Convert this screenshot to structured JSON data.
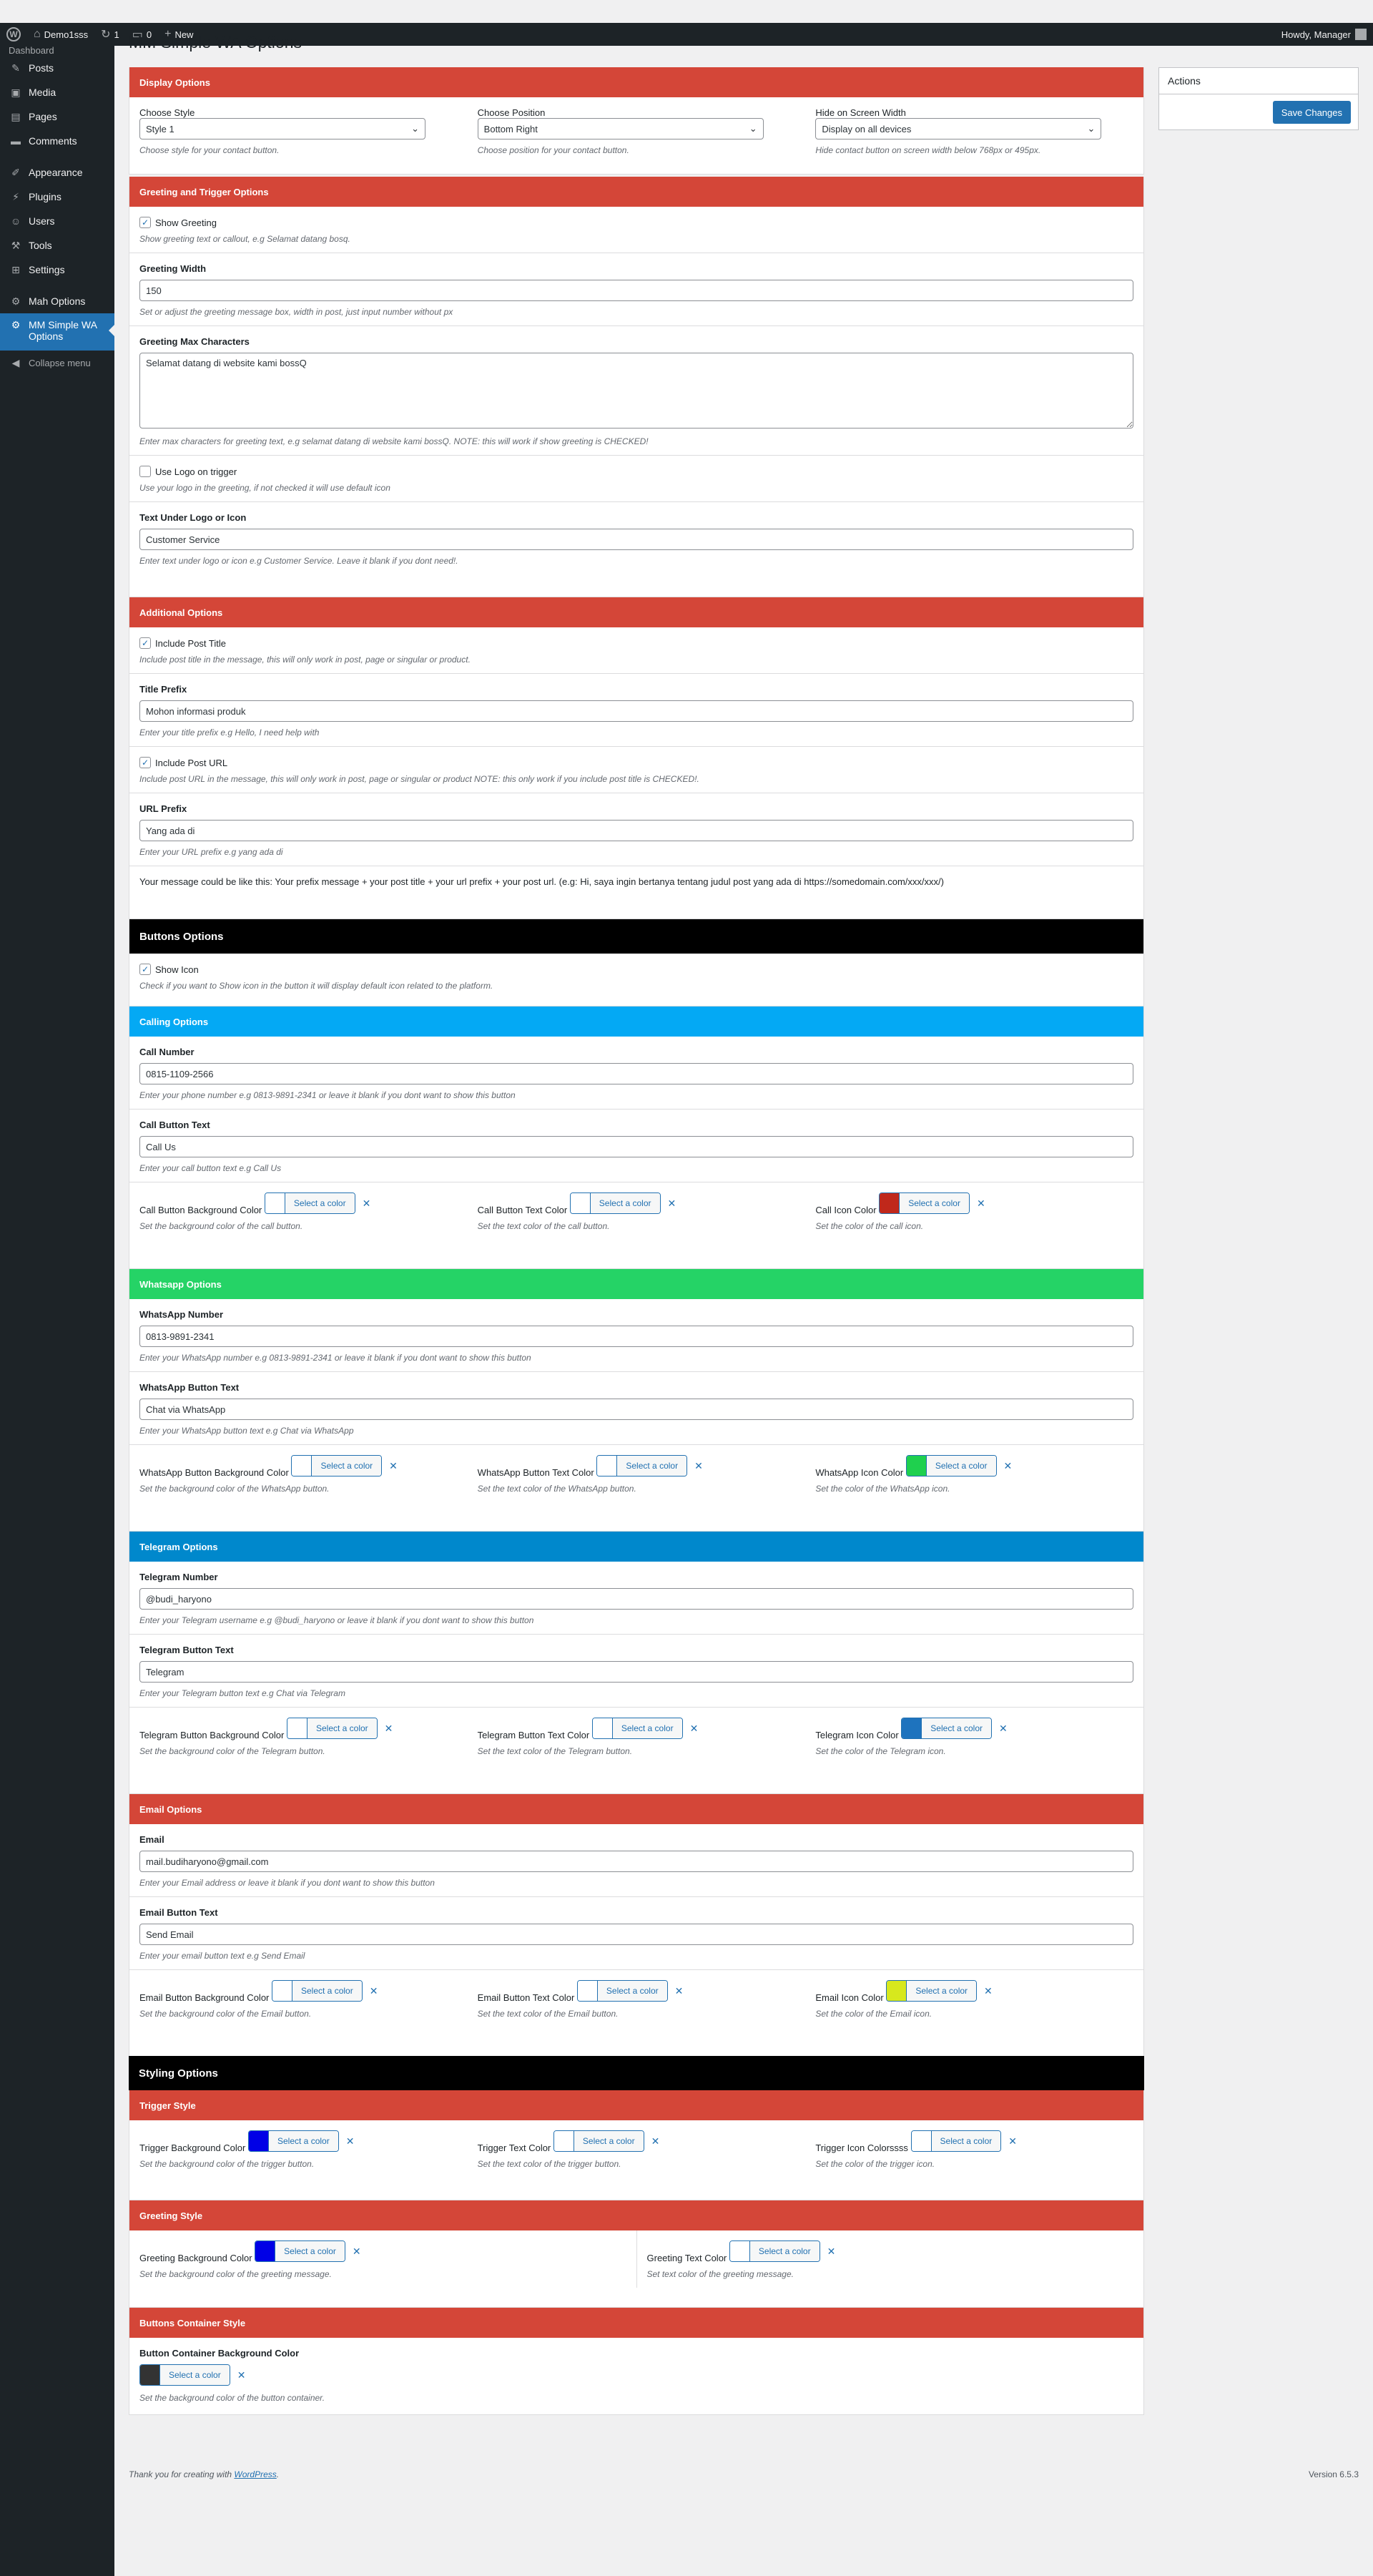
{
  "adminbar": {
    "site": "Demo1sss",
    "updates": "1",
    "comments": "0",
    "new": "New",
    "howdy": "Howdy, Manager"
  },
  "sidebar": {
    "cut": "Dashboard",
    "items": [
      "Posts",
      "Media",
      "Pages",
      "Comments",
      "Appearance",
      "Plugins",
      "Users",
      "Tools",
      "Settings",
      "Mah Options",
      "MM Simple WA Options",
      "Collapse menu"
    ]
  },
  "page_title": "MM Simple WA Options",
  "actions": {
    "title": "Actions",
    "save": "Save Changes"
  },
  "display": {
    "header": "Display Options",
    "style": {
      "label": "Choose Style",
      "value": "Style 1",
      "desc": "Choose style for your contact button."
    },
    "position": {
      "label": "Choose Position",
      "value": "Bottom Right",
      "desc": "Choose position for your contact button."
    },
    "hide": {
      "label": "Hide on Screen Width",
      "value": "Display on all devices",
      "desc": "Hide contact button on screen width below 768px or 495px."
    }
  },
  "greeting": {
    "header": "Greeting and Trigger Options",
    "show": {
      "label": "Show Greeting",
      "desc": "Show greeting text or callout, e.g Selamat datang bosq."
    },
    "width": {
      "label": "Greeting Width",
      "value": "150",
      "desc": "Set or adjust the greeting message box, width in post, just input number without px"
    },
    "max": {
      "label": "Greeting Max Characters",
      "value": "Selamat datang di website kami bossQ",
      "desc": "Enter max characters for greeting text, e.g selamat datang di website kami bossQ. NOTE: this will work if show greeting is CHECKED!"
    },
    "logo": {
      "label": "Use Logo on trigger",
      "desc": "Use your logo in the greeting, if not checked it will use default icon"
    },
    "under": {
      "label": "Text Under Logo or Icon",
      "value": "Customer Service",
      "desc": "Enter text under logo or icon e.g Customer Service. Leave it blank if you dont need!."
    }
  },
  "additional": {
    "header": "Additional Options",
    "title": {
      "label": "Include Post Title",
      "desc": "Include post title in the message, this will only work in post, page or singular or product."
    },
    "prefix": {
      "label": "Title Prefix",
      "value": "Mohon informasi produk",
      "desc": "Enter your title prefix e.g Hello, I need help with"
    },
    "url": {
      "label": "Include Post URL",
      "desc": "Include post URL in the message, this will only work in post, page or singular or product NOTE: this only work if you include post title is CHECKED!."
    },
    "urlprefix": {
      "label": "URL Prefix",
      "value": "Yang ada di",
      "desc": "Enter your URL prefix e.g yang ada di"
    },
    "message": "Your message could be like this: Your prefix message + your post title + your url prefix + your post url. (e.g: Hi, saya ingin bertanya tentang judul post yang ada di https://somedomain.com/xxx/xxx/)"
  },
  "buttons": {
    "header": "Buttons Options",
    "show": {
      "label": "Show Icon",
      "desc": "Check if you want to Show icon in the button it will display default icon related to the platform."
    }
  },
  "select_color": "Select a color",
  "calling": {
    "header": "Calling Options",
    "number": {
      "label": "Call Number",
      "value": "0815-1109-2566",
      "desc": "Enter your phone number e.g 0813-9891-2341 or leave it blank if you dont want to show this button"
    },
    "text": {
      "label": "Call Button Text",
      "value": "Call Us",
      "desc": "Enter your call button text e.g Call Us"
    },
    "c1": {
      "label": "Call Button Background Color",
      "desc": "Set the background color of the call button."
    },
    "c2": {
      "label": "Call Button Text Color",
      "desc": "Set the text color of the call button."
    },
    "c3": {
      "label": "Call Icon Color",
      "desc": "Set the color of the call icon."
    },
    "colors": [
      "#ffffff",
      "#ffffff",
      "#c0281b"
    ]
  },
  "whatsapp": {
    "header": "Whatsapp Options",
    "number": {
      "label": "WhatsApp Number",
      "value": "0813-9891-2341",
      "desc": "Enter your WhatsApp number e.g 0813-9891-2341 or leave it blank if you dont want to show this button"
    },
    "text": {
      "label": "WhatsApp Button Text",
      "value": "Chat via WhatsApp",
      "desc": "Enter your WhatsApp button text e.g Chat via WhatsApp"
    },
    "c1": {
      "label": "WhatsApp Button Background Color",
      "desc": "Set the background color of the WhatsApp button."
    },
    "c2": {
      "label": "WhatsApp Button Text Color",
      "desc": "Set the text color of the WhatsApp button."
    },
    "c3": {
      "label": "WhatsApp Icon Color",
      "desc": "Set the color of the WhatsApp icon."
    },
    "colors": [
      "#ffffff",
      "#ffffff",
      "#1fd04e"
    ]
  },
  "telegram": {
    "header": "Telegram Options",
    "number": {
      "label": "Telegram Number",
      "value": "@budi_haryono",
      "desc": "Enter your Telegram username e.g @budi_haryono or leave it blank if you dont want to show this button"
    },
    "text": {
      "label": "Telegram Button Text",
      "value": "Telegram",
      "desc": "Enter your Telegram button text e.g Chat via Telegram"
    },
    "c1": {
      "label": "Telegram Button Background Color",
      "desc": "Set the background color of the Telegram button."
    },
    "c2": {
      "label": "Telegram Button Text Color",
      "desc": "Set the text color of the Telegram button."
    },
    "c3": {
      "label": "Telegram Icon Color",
      "desc": "Set the color of the Telegram icon."
    },
    "colors": [
      "#ffffff",
      "#ffffff",
      "#1e73be"
    ]
  },
  "email": {
    "header": "Email Options",
    "number": {
      "label": "Email",
      "value": "mail.budiharyono@gmail.com",
      "desc": "Enter your Email address or leave it blank if you dont want to show this button"
    },
    "text": {
      "label": "Email Button Text",
      "value": "Send Email",
      "desc": "Enter your email button text e.g Send Email"
    },
    "c1": {
      "label": "Email Button Background Color",
      "desc": "Set the background color of the Email button."
    },
    "c2": {
      "label": "Email Button Text Color",
      "desc": "Set the text color of the Email button."
    },
    "c3": {
      "label": "Email Icon Color",
      "desc": "Set the color of the Email icon."
    },
    "colors": [
      "#ffffff",
      "#ffffff",
      "#d7e81d"
    ]
  },
  "styling": {
    "header": "Styling Options"
  },
  "trigger": {
    "header": "Trigger Style",
    "c1": {
      "label": "Trigger Background Color",
      "desc": "Set the background color of the trigger button."
    },
    "c2": {
      "label": "Trigger Text Color",
      "desc": "Set the text color of the trigger button."
    },
    "c3": {
      "label": "Trigger Icon Colorssss",
      "desc": "Set the color of the trigger icon."
    },
    "colors": [
      "#0000e6",
      "#ffffff",
      "#ffffff"
    ]
  },
  "greetingstyle": {
    "header": "Greeting Style",
    "c1": {
      "label": "Greeting Background Color",
      "desc": "Set the background color of the greeting message."
    },
    "c2": {
      "label": "Greeting Text Color",
      "desc": "Set text color of the greeting message."
    },
    "colors": [
      "#0000e6",
      "#ffffff"
    ]
  },
  "container": {
    "header": "Buttons Container Style",
    "c1": {
      "label": "Button Container Background Color",
      "desc": "Set the background color of the button container."
    },
    "colors": [
      "#333333"
    ]
  },
  "footer": {
    "thanks": "Thank you for creating with",
    "wp": "WordPress",
    "version": "Version 6.5.3"
  },
  "theme": {
    "red": "#d44638",
    "black": "#000000",
    "blue": "#04a9f4",
    "green": "#25d366",
    "tblue": "#0088cc",
    "wpblue": "#2271b1"
  }
}
